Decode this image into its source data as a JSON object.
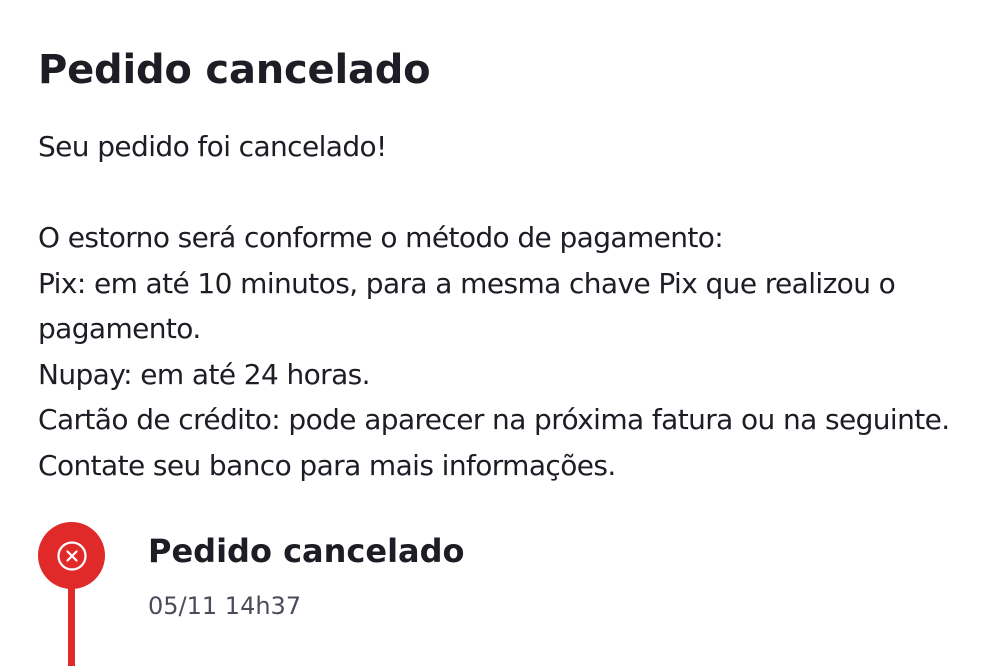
{
  "page": {
    "title": "Pedido cancelado"
  },
  "message": {
    "line1": "Seu pedido foi cancelado!",
    "line2": "O estorno será conforme o método de pagamento:",
    "line3": "Pix: em até 10 minutos, para a mesma chave Pix que realizou o pagamento.",
    "line4": "Nupay: em até 24 horas.",
    "line5": "Cartão de crédito: pode aparecer na próxima fatura ou na seguinte. Contate seu banco para mais informações."
  },
  "timeline": {
    "events": [
      {
        "icon": "cancel-circle-icon",
        "status_color": "#e02a2a",
        "title": "Pedido cancelado",
        "time": "05/11 14h37"
      }
    ]
  }
}
